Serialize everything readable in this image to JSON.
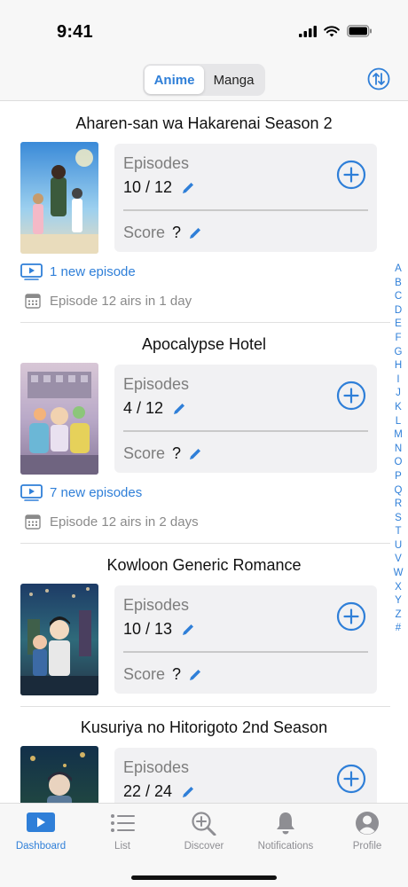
{
  "status_bar": {
    "time": "9:41"
  },
  "header": {
    "segments": [
      {
        "label": "Anime"
      },
      {
        "label": "Manga"
      }
    ],
    "selected": "Anime"
  },
  "entries": [
    {
      "title": "Aharen-san wa Hakarenai Season 2",
      "episodes_label": "Episodes",
      "progress": "10 / 12",
      "score_label": "Score",
      "score": "?",
      "new_episodes": "1 new episode",
      "airing": "Episode 12 airs in 1 day"
    },
    {
      "title": "Apocalypse Hotel",
      "episodes_label": "Episodes",
      "progress": "4 / 12",
      "score_label": "Score",
      "score": "?",
      "new_episodes": "7 new episodes",
      "airing": "Episode 12 airs in 2 days"
    },
    {
      "title": "Kowloon Generic Romance",
      "episodes_label": "Episodes",
      "progress": "10 / 13",
      "score_label": "Score",
      "score": "?"
    },
    {
      "title": "Kusuriya no Hitorigoto 2nd Season",
      "episodes_label": "Episodes",
      "progress": "22 / 24"
    }
  ],
  "alphabet_index": [
    "A",
    "B",
    "C",
    "D",
    "E",
    "F",
    "G",
    "H",
    "I",
    "J",
    "K",
    "L",
    "M",
    "N",
    "O",
    "P",
    "Q",
    "R",
    "S",
    "T",
    "U",
    "V",
    "W",
    "X",
    "Y",
    "Z",
    "#"
  ],
  "tabbar": {
    "tabs": [
      {
        "label": "Dashboard",
        "icon": "play-rectangle-icon"
      },
      {
        "label": "List",
        "icon": "list-icon"
      },
      {
        "label": "Discover",
        "icon": "magnifying-glass-plus-icon"
      },
      {
        "label": "Notifications",
        "icon": "bell-icon"
      },
      {
        "label": "Profile",
        "icon": "person-circle-icon"
      }
    ],
    "selected": "Dashboard"
  },
  "colors": {
    "accent": "#2f7fd8",
    "secondary_text": "#7d7d7d",
    "card_bg": "#f1f1f3"
  }
}
